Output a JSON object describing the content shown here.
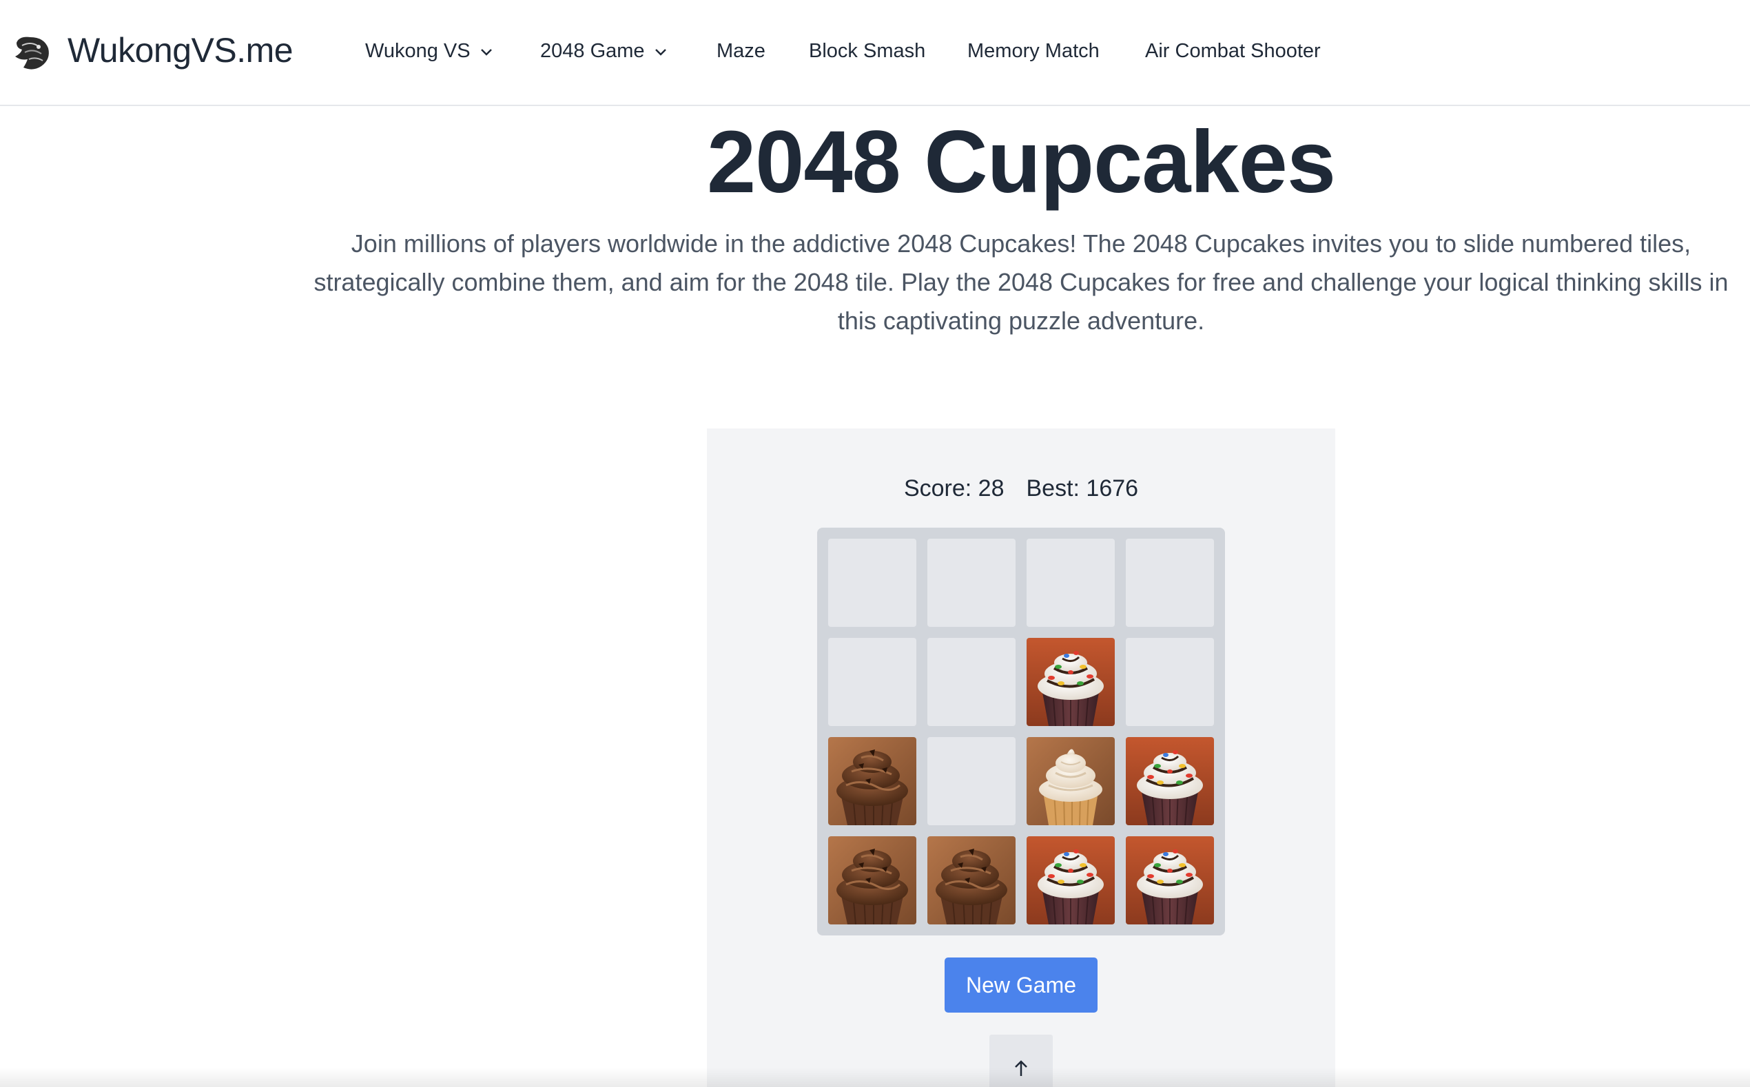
{
  "site": {
    "brand": "WukongVS.me",
    "logo_icon": "wukong-logo-icon"
  },
  "nav": {
    "items": [
      {
        "label": "Wukong VS",
        "has_dropdown": true
      },
      {
        "label": "2048 Game",
        "has_dropdown": true
      },
      {
        "label": "Maze",
        "has_dropdown": false
      },
      {
        "label": "Block Smash",
        "has_dropdown": false
      },
      {
        "label": "Memory Match",
        "has_dropdown": false
      },
      {
        "label": "Air Combat Shooter",
        "has_dropdown": false
      }
    ]
  },
  "hero": {
    "title": "2048 Cupcakes",
    "description": "Join millions of players worldwide in the addictive 2048 Cupcakes! The 2048 Cupcakes invites you to slide numbered tiles, strategically combine them, and aim for the 2048 tile. Play the 2048 Cupcakes for free and challenge your logical thinking skills in this captivating puzzle adventure."
  },
  "game": {
    "score_text": "Score: 28",
    "best_text": "Best: 1676",
    "board": [
      [
        "empty",
        "empty",
        "empty",
        "empty"
      ],
      [
        "empty",
        "empty",
        "sprinkle-cupcake",
        "empty"
      ],
      [
        "chocolate-cupcake",
        "empty",
        "vanilla-cupcake",
        "sprinkle-cupcake"
      ],
      [
        "chocolate-cupcake",
        "chocolate-cupcake",
        "sprinkle-cupcake",
        "sprinkle-cupcake"
      ]
    ],
    "new_game_label": "New Game",
    "scroll_top_icon": "arrow-up-icon"
  },
  "colors": {
    "accent": "#4b83ec",
    "text_dark": "#1f2937",
    "text_muted": "#4b5563",
    "panel_bg": "#f3f4f6",
    "board_bg": "#d1d5db",
    "cell_empty": "#e5e7eb"
  }
}
